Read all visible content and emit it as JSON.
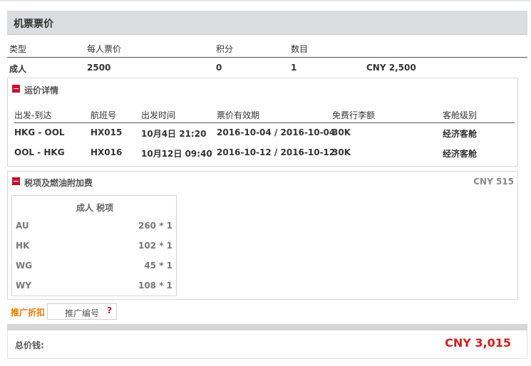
{
  "page": {
    "title": "机票票价"
  },
  "summary": {
    "headers": {
      "type": "类型",
      "price": "每人票价",
      "points": "积分",
      "count": "数目"
    },
    "adult": {
      "type": "成人",
      "price": "2500",
      "points": "0",
      "count": "1",
      "total": "CNY 2,500"
    }
  },
  "fare_details": {
    "title": "运价详情",
    "headers": {
      "route": "出发-到达",
      "flight": "航班号",
      "dep_time": "出发时间",
      "validity": "票价有效期",
      "baggage": "免费行李额",
      "cabin": "客舱级别"
    },
    "rows": [
      {
        "route": "HKG - OOL",
        "flight": "HX015",
        "dep_time": "10月4日 21:20",
        "validity": "2016-10-04 / 2016-10-04",
        "baggage": "30K",
        "cabin": "经济客舱"
      },
      {
        "route": "OOL - HKG",
        "flight": "HX016",
        "dep_time": "10月12日 09:40",
        "validity": "2016-10-12 / 2016-10-12",
        "baggage": "30K",
        "cabin": "经济客舱"
      }
    ]
  },
  "tax": {
    "title": "税项及燃油附加费",
    "total": "CNY 515",
    "table_header": "成人 税项",
    "rows": [
      {
        "code": "AU",
        "amount": "260 * 1"
      },
      {
        "code": "HK",
        "amount": "102 * 1"
      },
      {
        "code": "WG",
        "amount": "45 * 1"
      },
      {
        "code": "WY",
        "amount": "108 * 1"
      }
    ]
  },
  "promo": {
    "label": "推广折扣",
    "placeholder": "推广编号",
    "help": "?"
  },
  "total": {
    "label": "总价钱:",
    "value": "CNY 3,015"
  },
  "colors": {
    "accent_red": "#d21f1f",
    "promo_orange": "#ea7a07",
    "header_bg": "#dcdde0"
  }
}
